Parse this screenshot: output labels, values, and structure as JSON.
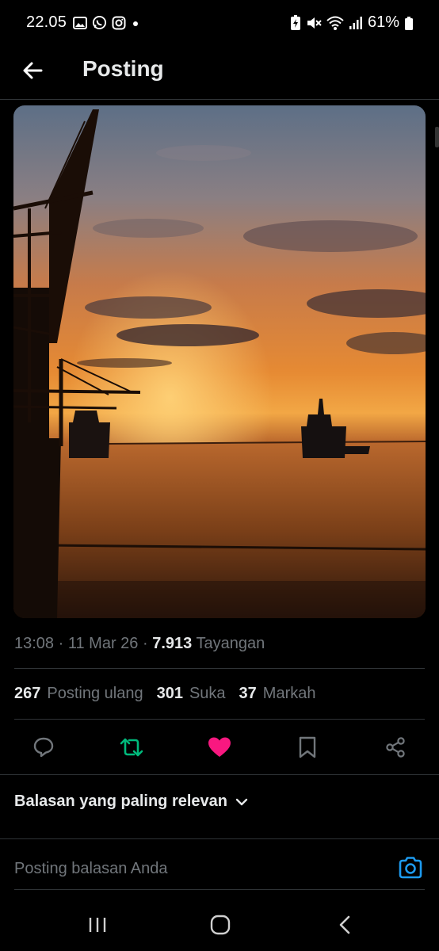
{
  "status_bar": {
    "time": "22.05",
    "battery": "61%",
    "icons": [
      "gallery-icon",
      "whatsapp-icon",
      "instagram-icon",
      "dot-icon",
      "battery-saver-icon",
      "mute-icon",
      "wifi-icon",
      "signal-icon",
      "battery-icon"
    ]
  },
  "header": {
    "title": "Posting",
    "back_icon": "arrow-left-icon"
  },
  "post": {
    "image_alt": "sunset-harbor-photo",
    "time": "13:08",
    "date": "11 Mar 26",
    "views_count": "7.913",
    "views_label": "Tayangan",
    "separator": "·"
  },
  "stats": {
    "reposts_count": "267",
    "reposts_label": "Posting ulang",
    "likes_count": "301",
    "likes_label": "Suka",
    "bookmarks_count": "37",
    "bookmarks_label": "Markah"
  },
  "actions": {
    "icons": [
      "reply-icon",
      "repost-icon",
      "like-icon",
      "bookmark-icon",
      "share-icon"
    ],
    "colors": {
      "repost": "#00ba7c",
      "like": "#f91880",
      "default": "#71767b"
    }
  },
  "replies": {
    "sort_label": "Balasan yang paling relevan",
    "placeholder": "Posting balasan Anda"
  },
  "colors": {
    "accent": "#1d9bf0",
    "background": "#000000",
    "muted_text": "#71767b"
  },
  "nav": {
    "icons": [
      "recent-apps-icon",
      "home-icon",
      "back-icon"
    ]
  }
}
